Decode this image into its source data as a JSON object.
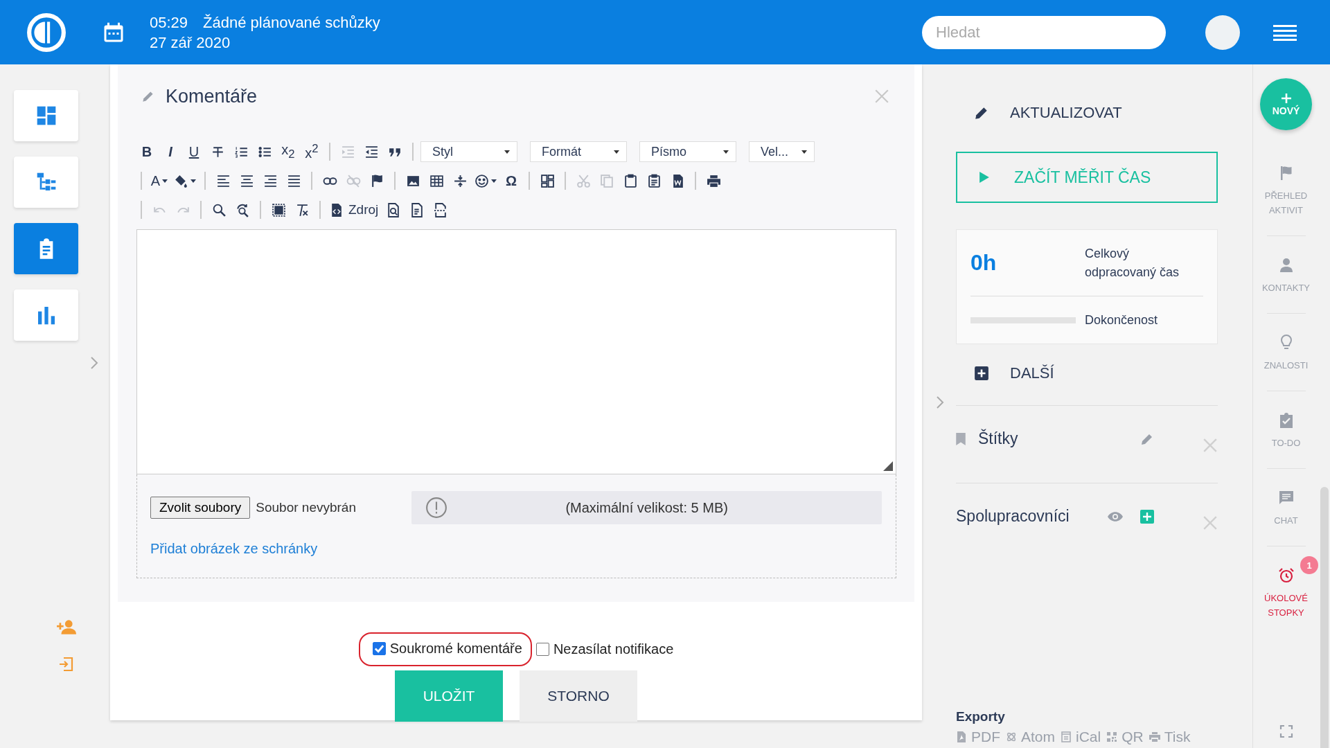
{
  "header": {
    "time": "05:29",
    "meetings": "Žádné plánované schůzky",
    "date": "27 zář 2020",
    "search": {
      "placeholder": "Hledat"
    }
  },
  "left_nav": [
    {
      "selected": false
    },
    {
      "selected": false
    },
    {
      "selected": true
    },
    {
      "selected": false
    }
  ],
  "editor": {
    "title": "Komentáře",
    "toolbar": [
      [
        {
          "kind": "glyph",
          "label": "B",
          "disabled": false
        },
        {
          "kind": "glyph",
          "label": "I",
          "disabled": false
        },
        {
          "kind": "glyph",
          "label": "U",
          "disabled": false
        },
        {
          "kind": "icon",
          "disabled": false
        },
        {
          "kind": "icon",
          "disabled": false
        },
        {
          "kind": "icon",
          "disabled": false
        },
        {
          "kind": "glyph",
          "label": "x$_{2}$",
          "disabled": false
        },
        {
          "kind": "glyph",
          "label": "x$^{2}$",
          "disabled": false
        },
        {
          "kind": "sep"
        },
        {
          "kind": "icon",
          "disabled": true
        },
        {
          "kind": "icon",
          "disabled": false
        },
        {
          "kind": "icon",
          "disabled": false
        },
        {
          "kind": "sep"
        },
        {
          "kind": "combo",
          "label": "Styl"
        },
        {
          "kind": "combo",
          "label": "Formát"
        },
        {
          "kind": "combo",
          "label": "Písmo"
        },
        {
          "kind": "combo",
          "label": "Vel..."
        }
      ],
      [
        {
          "kind": "sep"
        },
        {
          "kind": "glyph",
          "label": "A",
          "disabled": false
        },
        {
          "kind": "icon",
          "disabled": false
        },
        {
          "kind": "sep"
        },
        {
          "kind": "icon",
          "disabled": false
        },
        {
          "kind": "icon",
          "disabled": false
        },
        {
          "kind": "icon",
          "disabled": false
        },
        {
          "kind": "icon",
          "disabled": false
        },
        {
          "kind": "sep"
        },
        {
          "kind": "icon",
          "disabled": false
        },
        {
          "kind": "icon",
          "disabled": true
        },
        {
          "kind": "icon",
          "disabled": false
        },
        {
          "kind": "sep"
        },
        {
          "kind": "icon",
          "disabled": false
        },
        {
          "kind": "icon",
          "disabled": false
        },
        {
          "kind": "icon",
          "disabled": false
        },
        {
          "kind": "icon",
          "disabled": false
        },
        {
          "kind": "glyph",
          "label": "Ω",
          "disabled": false
        },
        {
          "kind": "sep"
        },
        {
          "kind": "icon",
          "disabled": false
        },
        {
          "kind": "sep"
        },
        {
          "kind": "icon",
          "disabled": true
        },
        {
          "kind": "icon",
          "disabled": true
        },
        {
          "kind": "icon",
          "disabled": false
        },
        {
          "kind": "icon",
          "disabled": false
        },
        {
          "kind": "icon",
          "disabled": false
        },
        {
          "kind": "sep"
        },
        {
          "kind": "icon",
          "disabled": false
        }
      ],
      [
        {
          "kind": "sep"
        },
        {
          "kind": "icon",
          "disabled": true
        },
        {
          "kind": "icon",
          "disabled": true
        },
        {
          "kind": "sep"
        },
        {
          "kind": "icon",
          "disabled": false
        },
        {
          "kind": "icon",
          "disabled": false
        },
        {
          "kind": "sep"
        },
        {
          "kind": "icon",
          "disabled": false
        },
        {
          "kind": "icon",
          "disabled": false
        },
        {
          "kind": "sep"
        },
        {
          "kind": "icon",
          "label": "Zdroj",
          "disabled": false
        },
        {
          "kind": "icon",
          "disabled": false
        },
        {
          "kind": "icon",
          "disabled": false
        },
        {
          "kind": "icon",
          "disabled": false
        }
      ]
    ],
    "attachments": {
      "button": "Zvolit soubory",
      "status": "Soubor nevybrán",
      "limit": "(Maximální velikost: 5 MB)",
      "paste_link": "Přidat obrázek ze schránky"
    }
  },
  "options": [
    {
      "label": "Soukromé komentáře",
      "checked": true,
      "highlighted": true
    },
    {
      "label": "Nezasílat notifikace",
      "checked": false,
      "highlighted": false
    }
  ],
  "actions": [
    {
      "label": "ULOŽIT",
      "kind": "primary"
    },
    {
      "label": "STORNO",
      "kind": "secondary"
    }
  ],
  "sidebar": {
    "update": "AKTUALIZOVAT",
    "timer": "ZAČÍT MĚŘIT ČAS",
    "stats": {
      "hours": "0h",
      "hours_label": "Celkový odpracovaný čas",
      "progress_label": "Dokončenost",
      "level": 0
    },
    "more": "DALŠÍ",
    "sections": [
      {
        "title": "Štítky",
        "kind": "tags"
      },
      {
        "title": "Spolupracovníci",
        "kind": "watchers"
      }
    ],
    "exports": {
      "title": "Exporty",
      "links": [
        {
          "label": "PDF"
        },
        {
          "label": "Atom"
        },
        {
          "label": "iCal"
        },
        {
          "label": "QR"
        },
        {
          "label": "Tisk"
        }
      ]
    }
  },
  "rail": {
    "new": "NOVÝ",
    "items": [
      {
        "label": "PŘEHLED AKTIVIT",
        "selected": false
      },
      {
        "label": "KONTAKTY",
        "selected": false
      },
      {
        "label": "ZNALOSTI",
        "selected": false
      },
      {
        "label": "TO-DO",
        "selected": false
      },
      {
        "label": "CHAT",
        "selected": false
      },
      {
        "label": "ÚKOLOVÉ STOPKY",
        "selected": true,
        "badge": "1"
      }
    ]
  }
}
